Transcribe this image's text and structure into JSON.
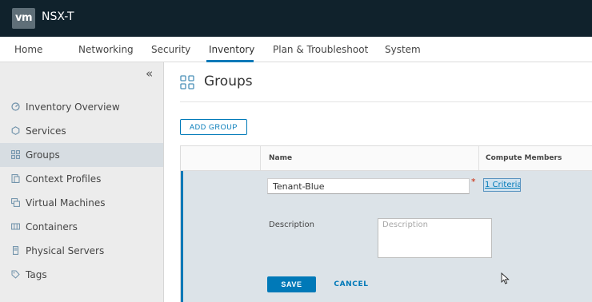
{
  "header": {
    "logo": "vm",
    "title": "NSX-T"
  },
  "nav": {
    "tabs": [
      "Home",
      "Networking",
      "Security",
      "Inventory",
      "Plan & Troubleshoot",
      "System"
    ],
    "active": "Inventory"
  },
  "sidebar": {
    "collapse_icon": "double-chevron-left-icon",
    "items": [
      {
        "label": "Inventory Overview",
        "icon": "dashboard-icon"
      },
      {
        "label": "Services",
        "icon": "services-icon"
      },
      {
        "label": "Groups",
        "icon": "groups-icon",
        "active": true
      },
      {
        "label": "Context Profiles",
        "icon": "context-profile-icon"
      },
      {
        "label": "Virtual Machines",
        "icon": "vm-icon"
      },
      {
        "label": "Containers",
        "icon": "containers-icon"
      },
      {
        "label": "Physical Servers",
        "icon": "server-icon"
      },
      {
        "label": "Tags",
        "icon": "tag-icon"
      }
    ]
  },
  "main": {
    "title": "Groups",
    "add_button": "ADD GROUP",
    "table": {
      "columns": [
        "",
        "Name",
        "Compute Members"
      ],
      "edit_row": {
        "name_value": "Tenant-Blue",
        "required_marker": "*",
        "criteria_link": "1 Criteria",
        "description_label": "Description",
        "description_placeholder": "Description",
        "save_label": "SAVE",
        "cancel_label": "CANCEL"
      }
    }
  },
  "colors": {
    "header_bg": "#10222c",
    "accent": "#0079b8",
    "sidebar_bg": "#ececec",
    "edit_row_bg": "#dce3e8"
  }
}
